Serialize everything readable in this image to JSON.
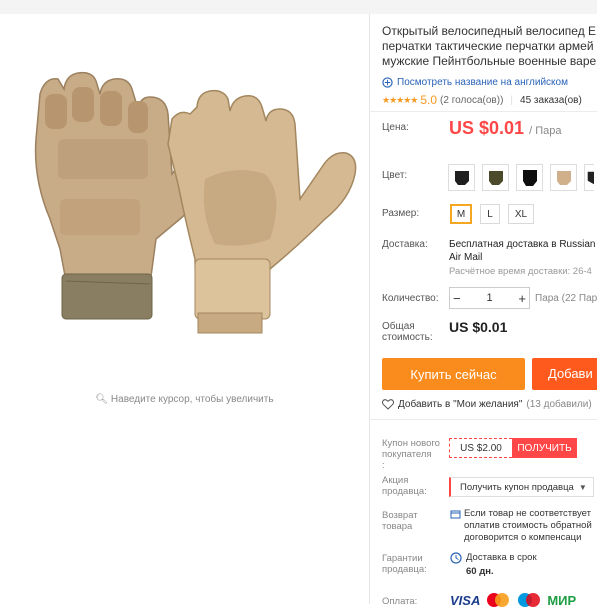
{
  "image": {
    "zoom_hint": "Наведите курсор, чтобы увеличить"
  },
  "product": {
    "title_lines": [
      "Открытый велосипедный велосипед E",
      "перчатки тактические перчатки армей",
      "мужские Пейнтбольные военные варе"
    ],
    "translate_link": "Посмотреть название на английском",
    "rating": {
      "stars": "★★★★★",
      "score": "5.0",
      "votes": "(2 голоса(ов))",
      "orders": "45 заказа(ов)"
    }
  },
  "price": {
    "label": "Цена:",
    "value": "US $0.01",
    "per": "/ Пара"
  },
  "color": {
    "label": "Цвет:",
    "swatches": [
      "#1f1f1f",
      "#4b4a2a",
      "#0e0e0e",
      "#cfb08a",
      "#222"
    ]
  },
  "size": {
    "label": "Размер:",
    "options": [
      "M",
      "L",
      "XL"
    ],
    "selected": "M"
  },
  "shipping": {
    "label": "Доставка:",
    "line1": "Бесплатная доставка в Russian",
    "line2": "Air Mail",
    "time": "Расчётное время доставки: 26-4"
  },
  "quantity": {
    "label": "Количество:",
    "minus": "−",
    "value": "1",
    "plus": "+",
    "available": "Пара (22 Пара"
  },
  "total": {
    "label_line1": "Общая",
    "label_line2": "стоимость:",
    "value": "US $0.01"
  },
  "buttons": {
    "buy_now": "Купить сейчас",
    "add_to_cart": "Добави"
  },
  "wishlist": {
    "text": "Добавить в \"Мои желания\"",
    "count": "(13 добавили)"
  },
  "coupon": {
    "label_lines": [
      "Купон нового",
      "покупателя",
      ":"
    ],
    "amount": "US $2.00",
    "button": "ПОЛУЧИТЬ"
  },
  "promo": {
    "label_lines": [
      "Акция",
      "продавца:"
    ],
    "button": "Получить купон продавца"
  },
  "returns": {
    "label_lines": [
      "Возврат",
      "товара"
    ],
    "text_lines": [
      "Если товар не соответствует",
      "оплатив стоимость обратной",
      "договорится о компенсаци"
    ]
  },
  "guarantee": {
    "label_lines": [
      "Гарантии",
      "продавца:"
    ],
    "line1": "Доставка в срок",
    "line2": "60 дн."
  },
  "payment": {
    "label": "Оплата:",
    "visa": "VISA",
    "mir": "МИР"
  }
}
